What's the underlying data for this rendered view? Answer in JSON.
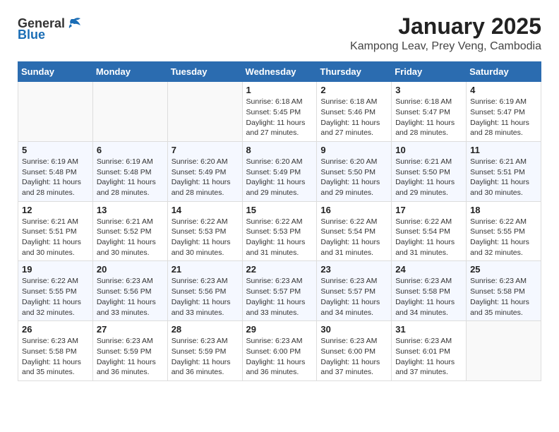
{
  "header": {
    "logo_general": "General",
    "logo_blue": "Blue",
    "title": "January 2025",
    "location": "Kampong Leav, Prey Veng, Cambodia"
  },
  "weekdays": [
    "Sunday",
    "Monday",
    "Tuesday",
    "Wednesday",
    "Thursday",
    "Friday",
    "Saturday"
  ],
  "weeks": [
    [
      {
        "day": "",
        "info": ""
      },
      {
        "day": "",
        "info": ""
      },
      {
        "day": "",
        "info": ""
      },
      {
        "day": "1",
        "info": "Sunrise: 6:18 AM\nSunset: 5:45 PM\nDaylight: 11 hours\nand 27 minutes."
      },
      {
        "day": "2",
        "info": "Sunrise: 6:18 AM\nSunset: 5:46 PM\nDaylight: 11 hours\nand 27 minutes."
      },
      {
        "day": "3",
        "info": "Sunrise: 6:18 AM\nSunset: 5:47 PM\nDaylight: 11 hours\nand 28 minutes."
      },
      {
        "day": "4",
        "info": "Sunrise: 6:19 AM\nSunset: 5:47 PM\nDaylight: 11 hours\nand 28 minutes."
      }
    ],
    [
      {
        "day": "5",
        "info": "Sunrise: 6:19 AM\nSunset: 5:48 PM\nDaylight: 11 hours\nand 28 minutes."
      },
      {
        "day": "6",
        "info": "Sunrise: 6:19 AM\nSunset: 5:48 PM\nDaylight: 11 hours\nand 28 minutes."
      },
      {
        "day": "7",
        "info": "Sunrise: 6:20 AM\nSunset: 5:49 PM\nDaylight: 11 hours\nand 28 minutes."
      },
      {
        "day": "8",
        "info": "Sunrise: 6:20 AM\nSunset: 5:49 PM\nDaylight: 11 hours\nand 29 minutes."
      },
      {
        "day": "9",
        "info": "Sunrise: 6:20 AM\nSunset: 5:50 PM\nDaylight: 11 hours\nand 29 minutes."
      },
      {
        "day": "10",
        "info": "Sunrise: 6:21 AM\nSunset: 5:50 PM\nDaylight: 11 hours\nand 29 minutes."
      },
      {
        "day": "11",
        "info": "Sunrise: 6:21 AM\nSunset: 5:51 PM\nDaylight: 11 hours\nand 30 minutes."
      }
    ],
    [
      {
        "day": "12",
        "info": "Sunrise: 6:21 AM\nSunset: 5:51 PM\nDaylight: 11 hours\nand 30 minutes."
      },
      {
        "day": "13",
        "info": "Sunrise: 6:21 AM\nSunset: 5:52 PM\nDaylight: 11 hours\nand 30 minutes."
      },
      {
        "day": "14",
        "info": "Sunrise: 6:22 AM\nSunset: 5:53 PM\nDaylight: 11 hours\nand 30 minutes."
      },
      {
        "day": "15",
        "info": "Sunrise: 6:22 AM\nSunset: 5:53 PM\nDaylight: 11 hours\nand 31 minutes."
      },
      {
        "day": "16",
        "info": "Sunrise: 6:22 AM\nSunset: 5:54 PM\nDaylight: 11 hours\nand 31 minutes."
      },
      {
        "day": "17",
        "info": "Sunrise: 6:22 AM\nSunset: 5:54 PM\nDaylight: 11 hours\nand 31 minutes."
      },
      {
        "day": "18",
        "info": "Sunrise: 6:22 AM\nSunset: 5:55 PM\nDaylight: 11 hours\nand 32 minutes."
      }
    ],
    [
      {
        "day": "19",
        "info": "Sunrise: 6:22 AM\nSunset: 5:55 PM\nDaylight: 11 hours\nand 32 minutes."
      },
      {
        "day": "20",
        "info": "Sunrise: 6:23 AM\nSunset: 5:56 PM\nDaylight: 11 hours\nand 33 minutes."
      },
      {
        "day": "21",
        "info": "Sunrise: 6:23 AM\nSunset: 5:56 PM\nDaylight: 11 hours\nand 33 minutes."
      },
      {
        "day": "22",
        "info": "Sunrise: 6:23 AM\nSunset: 5:57 PM\nDaylight: 11 hours\nand 33 minutes."
      },
      {
        "day": "23",
        "info": "Sunrise: 6:23 AM\nSunset: 5:57 PM\nDaylight: 11 hours\nand 34 minutes."
      },
      {
        "day": "24",
        "info": "Sunrise: 6:23 AM\nSunset: 5:58 PM\nDaylight: 11 hours\nand 34 minutes."
      },
      {
        "day": "25",
        "info": "Sunrise: 6:23 AM\nSunset: 5:58 PM\nDaylight: 11 hours\nand 35 minutes."
      }
    ],
    [
      {
        "day": "26",
        "info": "Sunrise: 6:23 AM\nSunset: 5:58 PM\nDaylight: 11 hours\nand 35 minutes."
      },
      {
        "day": "27",
        "info": "Sunrise: 6:23 AM\nSunset: 5:59 PM\nDaylight: 11 hours\nand 36 minutes."
      },
      {
        "day": "28",
        "info": "Sunrise: 6:23 AM\nSunset: 5:59 PM\nDaylight: 11 hours\nand 36 minutes."
      },
      {
        "day": "29",
        "info": "Sunrise: 6:23 AM\nSunset: 6:00 PM\nDaylight: 11 hours\nand 36 minutes."
      },
      {
        "day": "30",
        "info": "Sunrise: 6:23 AM\nSunset: 6:00 PM\nDaylight: 11 hours\nand 37 minutes."
      },
      {
        "day": "31",
        "info": "Sunrise: 6:23 AM\nSunset: 6:01 PM\nDaylight: 11 hours\nand 37 minutes."
      },
      {
        "day": "",
        "info": ""
      }
    ]
  ]
}
